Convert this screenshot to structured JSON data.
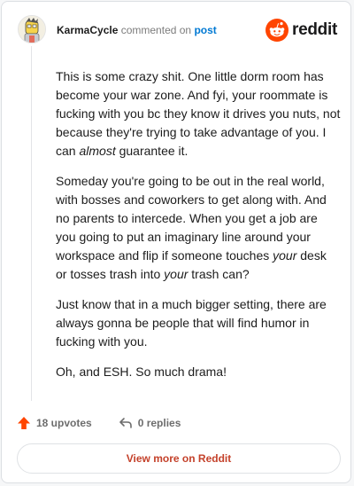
{
  "comment": {
    "username": "KarmaCycle",
    "action_text": "commented on",
    "post_link": "post",
    "paragraphs": [
      [
        {
          "text": "This is some crazy shit. One little dorm room has become your war zone. And fyi, your roommate is fucking with you bc they know it drives you nuts, not because they're trying to take advantage of you. I can ",
          "italic": false
        },
        {
          "text": "almost",
          "italic": true
        },
        {
          "text": " guarantee it.",
          "italic": false
        }
      ],
      [
        {
          "text": "Someday you're going to be out in the real world, with bosses and coworkers to get along with. And no parents to intercede. When you get a job are you going to put an imaginary line around your workspace and flip if someone touches ",
          "italic": false
        },
        {
          "text": "your",
          "italic": true
        },
        {
          "text": " desk or tosses trash into ",
          "italic": false
        },
        {
          "text": "your",
          "italic": true
        },
        {
          "text": " trash can?",
          "italic": false
        }
      ],
      [
        {
          "text": "Just know that in a much bigger setting, there are always gonna be people that will find humor in fucking with you.",
          "italic": false
        }
      ],
      [
        {
          "text": "Oh, and ESH. So much drama!",
          "italic": false
        }
      ]
    ],
    "upvotes_label": "18 upvotes",
    "replies_label": "0 replies"
  },
  "brand": {
    "name": "reddit",
    "icon": "reddit-logo-icon",
    "color": "#ff4500"
  },
  "view_more_label": "View more on Reddit",
  "colors": {
    "upvote": "#ff4500",
    "post_link": "#0079d3",
    "view_more": "#c4412a"
  }
}
